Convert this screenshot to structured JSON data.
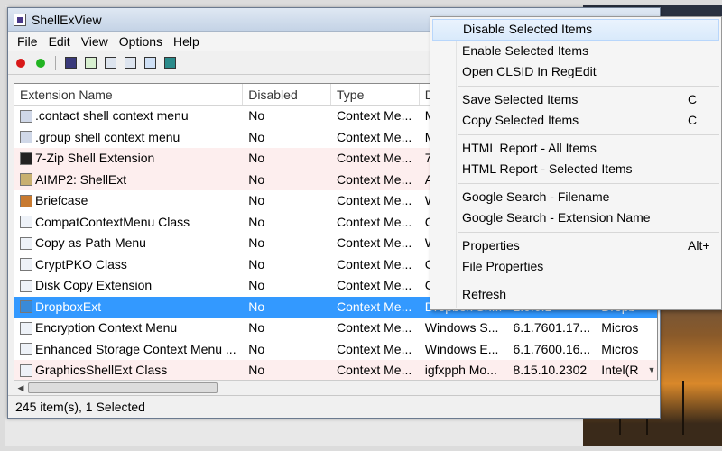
{
  "window": {
    "title": "ShellExView"
  },
  "menubar": [
    "File",
    "Edit",
    "View",
    "Options",
    "Help"
  ],
  "toolbar": {
    "icons": [
      "disable-red-icon",
      "enable-green-icon",
      "save-icon",
      "refresh-icon",
      "copy-icon",
      "properties-icon",
      "find-icon",
      "exit-icon"
    ],
    "colors": {
      "disable": "#d81818",
      "enable": "#22b422"
    }
  },
  "columns": [
    "Extension Name",
    "Disabled",
    "Type",
    "D",
    "",
    ""
  ],
  "rows": [
    {
      "name": ".contact shell context menu",
      "disabled": "No",
      "type": "Context Me...",
      "desc": "M",
      "version": "",
      "company": ""
    },
    {
      "name": ".group shell context menu",
      "disabled": "No",
      "type": "Context Me...",
      "desc": "M",
      "version": "",
      "company": ""
    },
    {
      "name": "7-Zip Shell Extension",
      "disabled": "No",
      "type": "Context Me...",
      "desc": "7",
      "version": "",
      "company": ""
    },
    {
      "name": "AIMP2: ShellExt",
      "disabled": "No",
      "type": "Context Me...",
      "desc": "A",
      "version": "",
      "company": ""
    },
    {
      "name": "Briefcase",
      "disabled": "No",
      "type": "Context Me...",
      "desc": "W",
      "version": "",
      "company": ""
    },
    {
      "name": "CompatContextMenu Class",
      "disabled": "No",
      "type": "Context Me...",
      "desc": "C",
      "version": "",
      "company": ""
    },
    {
      "name": "Copy as Path Menu",
      "disabled": "No",
      "type": "Context Me...",
      "desc": "W",
      "version": "",
      "company": ""
    },
    {
      "name": "CryptPKO Class",
      "disabled": "No",
      "type": "Context Me...",
      "desc": "C",
      "version": "",
      "company": ""
    },
    {
      "name": "Disk Copy Extension",
      "disabled": "No",
      "type": "Context Me...",
      "desc": "C",
      "version": "",
      "company": ""
    },
    {
      "name": "DropboxExt",
      "disabled": "No",
      "type": "Context Me...",
      "desc": "Dropbox Sh...",
      "version": "1.0.0.1",
      "company": "Dropb"
    },
    {
      "name": "Encryption Context Menu",
      "disabled": "No",
      "type": "Context Me...",
      "desc": "Windows S...",
      "version": "6.1.7601.17...",
      "company": "Micros"
    },
    {
      "name": "Enhanced Storage Context Menu ...",
      "disabled": "No",
      "type": "Context Me...",
      "desc": "Windows E...",
      "version": "6.1.7600.16...",
      "company": "Micros"
    },
    {
      "name": "GraphicsShellExt Class",
      "disabled": "No",
      "type": "Context Me...",
      "desc": "igfxpph Mo...",
      "version": "8.15.10.2302",
      "company": "Intel(R"
    }
  ],
  "status": "245 item(s), 1 Selected",
  "context_menu": {
    "groups": [
      [
        {
          "label": "Disable Selected Items",
          "shortcut": ""
        },
        {
          "label": "Enable Selected Items",
          "shortcut": ""
        },
        {
          "label": "Open CLSID In RegEdit",
          "shortcut": ""
        }
      ],
      [
        {
          "label": "Save Selected Items",
          "shortcut": "C"
        },
        {
          "label": "Copy Selected Items",
          "shortcut": "C"
        }
      ],
      [
        {
          "label": "HTML Report - All Items",
          "shortcut": ""
        },
        {
          "label": "HTML Report - Selected Items",
          "shortcut": ""
        }
      ],
      [
        {
          "label": "Google Search - Filename",
          "shortcut": ""
        },
        {
          "label": "Google Search - Extension Name",
          "shortcut": ""
        }
      ],
      [
        {
          "label": "Properties",
          "shortcut": "Alt+"
        },
        {
          "label": "File Properties",
          "shortcut": ""
        }
      ],
      [
        {
          "label": "Refresh",
          "shortcut": ""
        }
      ]
    ]
  }
}
